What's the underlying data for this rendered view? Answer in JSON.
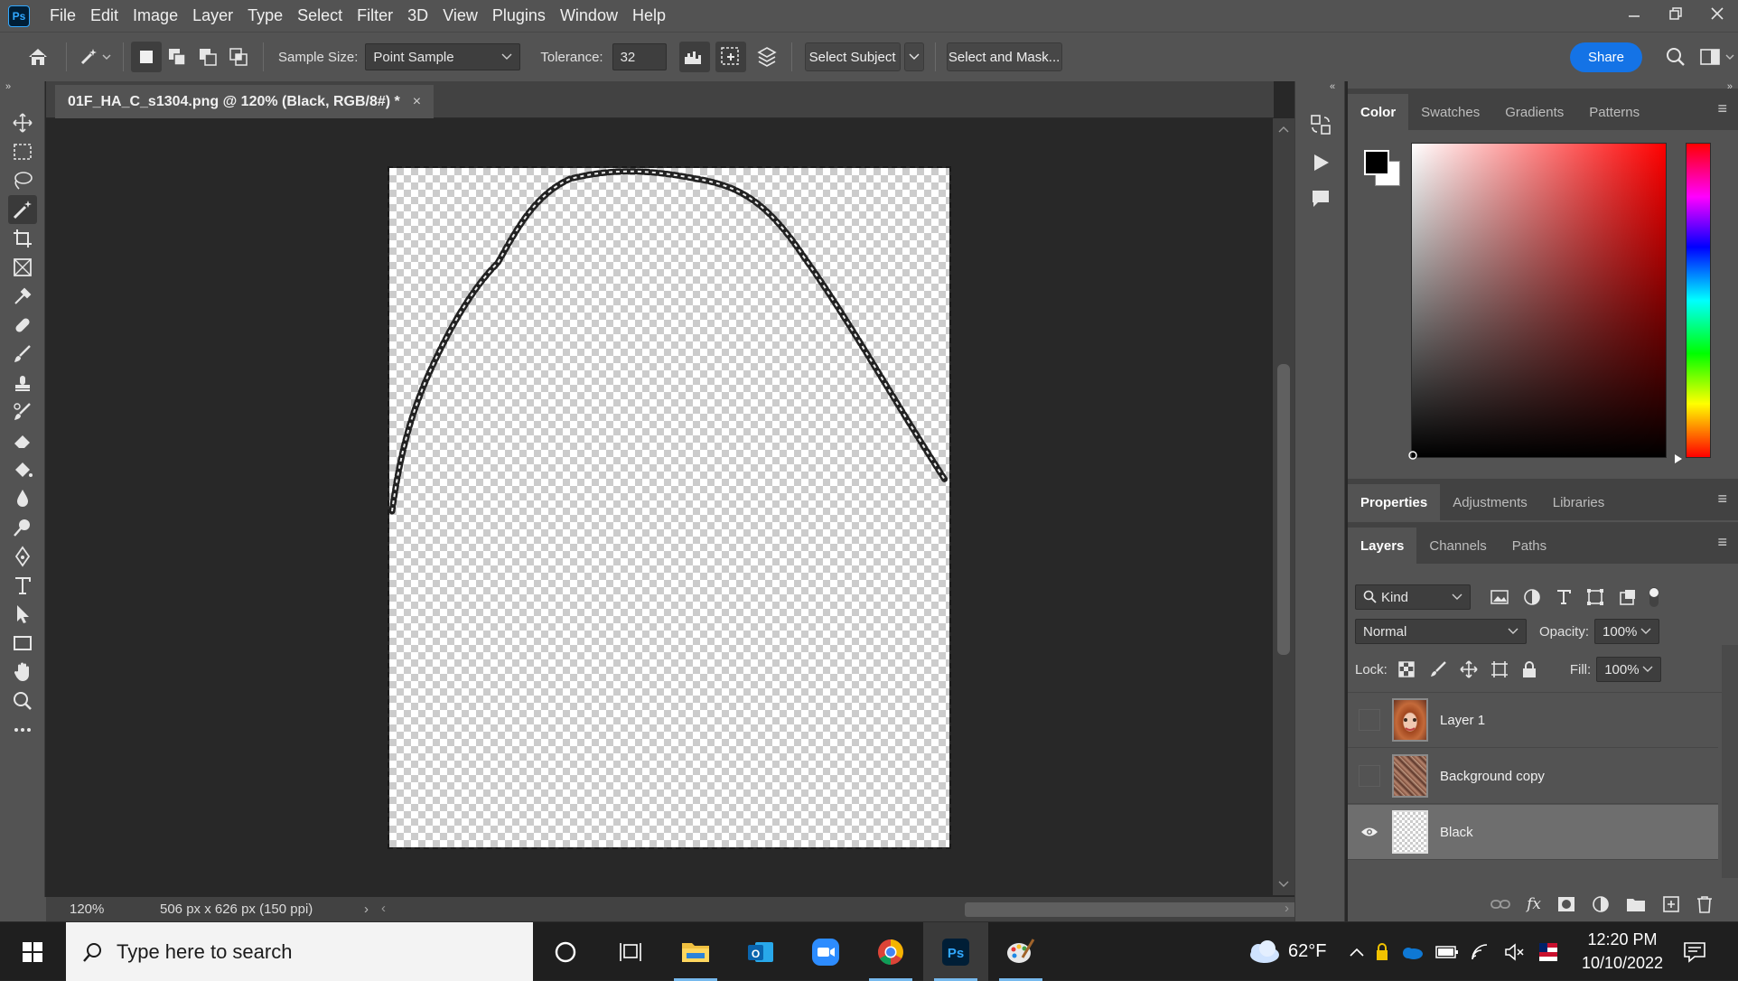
{
  "app": {
    "logo": "Ps"
  },
  "menu": [
    "File",
    "Edit",
    "Image",
    "Layer",
    "Type",
    "Select",
    "Filter",
    "3D",
    "View",
    "Plugins",
    "Window",
    "Help"
  ],
  "options": {
    "sample_size_label": "Sample Size:",
    "sample_size_value": "Point Sample",
    "tolerance_label": "Tolerance:",
    "tolerance_value": "32",
    "select_subject": "Select Subject",
    "select_and_mask": "Select and Mask...",
    "share": "Share"
  },
  "document": {
    "tab_title": "01F_HA_C_s1304.png @ 120% (Black, RGB/8#) *",
    "zoom": "120%",
    "doc_info": "506 px x 626 px (150 ppi)"
  },
  "color_panel": {
    "tabs": [
      "Color",
      "Swatches",
      "Gradients",
      "Patterns"
    ],
    "active_tab": "Color",
    "foreground": "#000000",
    "background": "#ffffff"
  },
  "properties_panel": {
    "tabs": [
      "Properties",
      "Adjustments",
      "Libraries"
    ],
    "active_tab": "Properties"
  },
  "layers_panel": {
    "tabs": [
      "Layers",
      "Channels",
      "Paths"
    ],
    "active_tab": "Layers",
    "filter_kind": "Kind",
    "blend_mode": "Normal",
    "opacity_label": "Opacity:",
    "opacity": "100%",
    "lock_label": "Lock:",
    "fill_label": "Fill:",
    "fill": "100%",
    "layers": [
      {
        "name": "Layer 1",
        "visible": false,
        "selected": false
      },
      {
        "name": "Background copy",
        "visible": false,
        "selected": false
      },
      {
        "name": "Black",
        "visible": true,
        "selected": true
      }
    ]
  },
  "taskbar": {
    "search_placeholder": "Type here to search",
    "weather_temp": "62°F",
    "time": "12:20 PM",
    "date": "10/10/2022",
    "apps": [
      "cortana-icon",
      "task-view-icon",
      "file-explorer-icon",
      "outlook-icon",
      "zoom-icon",
      "chrome-icon",
      "photoshop-icon",
      "paint-icon"
    ]
  }
}
